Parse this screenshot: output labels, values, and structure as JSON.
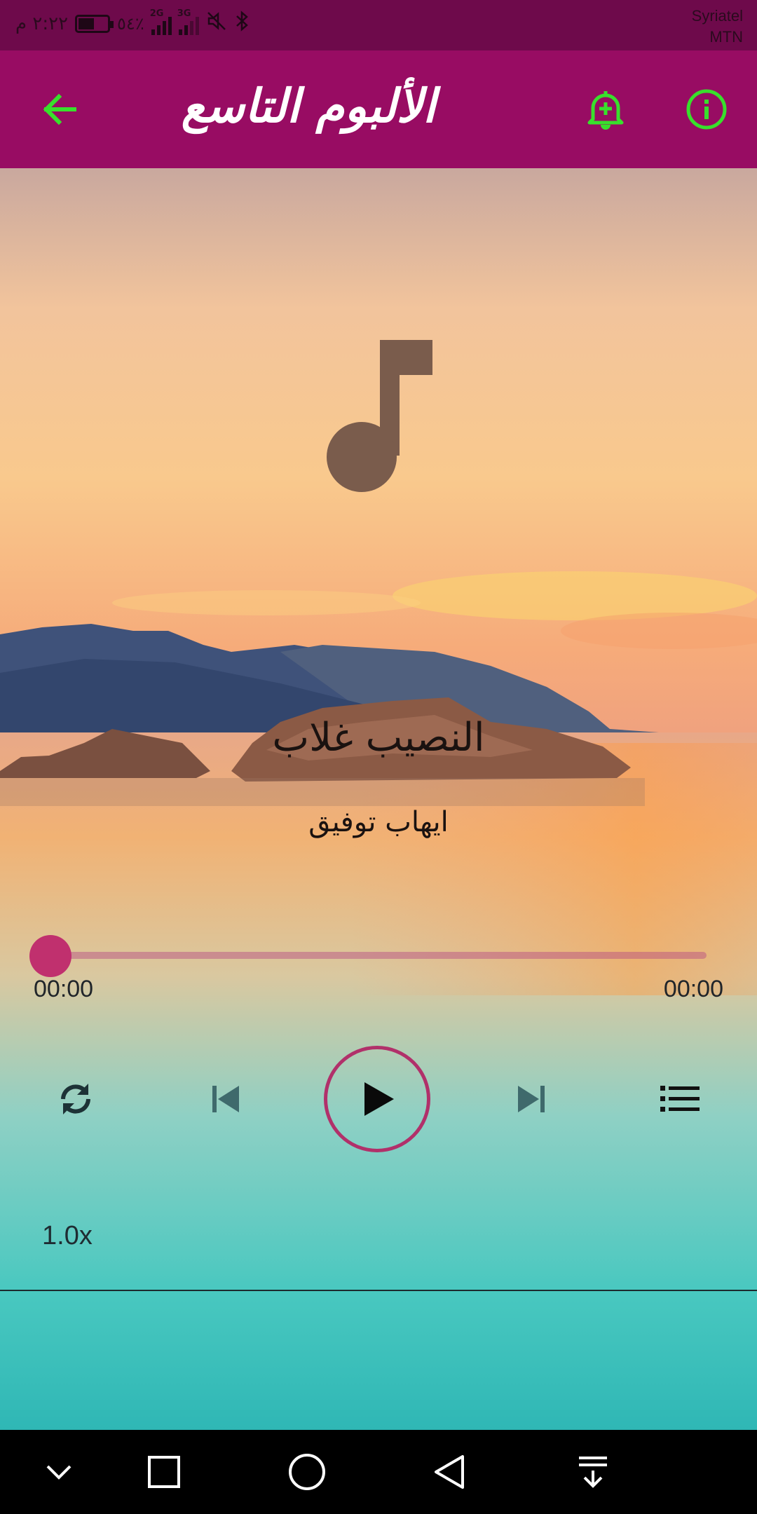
{
  "status_bar": {
    "time": "٢:٢٢ م",
    "battery_percent_label": "٥٤٪",
    "battery_level": 0.54,
    "network_1": "2G",
    "network_2": "3G",
    "carrier_1": "Syriatel",
    "carrier_2": "MTN"
  },
  "app_bar": {
    "title": "الألبوم التاسع",
    "back_icon": "arrow-left-icon",
    "notify_icon": "bell-plus-icon",
    "info_icon": "info-circle-icon",
    "icon_color": "#38e02c",
    "background": "#980c63"
  },
  "player": {
    "artwork_icon": "music-note-icon",
    "song_title": "النصيب غلاب",
    "artist": "ايهاب توفيق",
    "current_time": "00:00",
    "total_time": "00:00",
    "progress": 0,
    "speed": "1.0x",
    "accent_color": "#c0306e",
    "controls": [
      "repeat-icon",
      "previous-icon",
      "play-icon",
      "next-icon",
      "playlist-icon"
    ]
  },
  "nav_bar": {
    "buttons": [
      "chevron-down-icon",
      "square-recents-icon",
      "circle-home-icon",
      "triangle-back-icon",
      "download-notification-icon"
    ]
  }
}
